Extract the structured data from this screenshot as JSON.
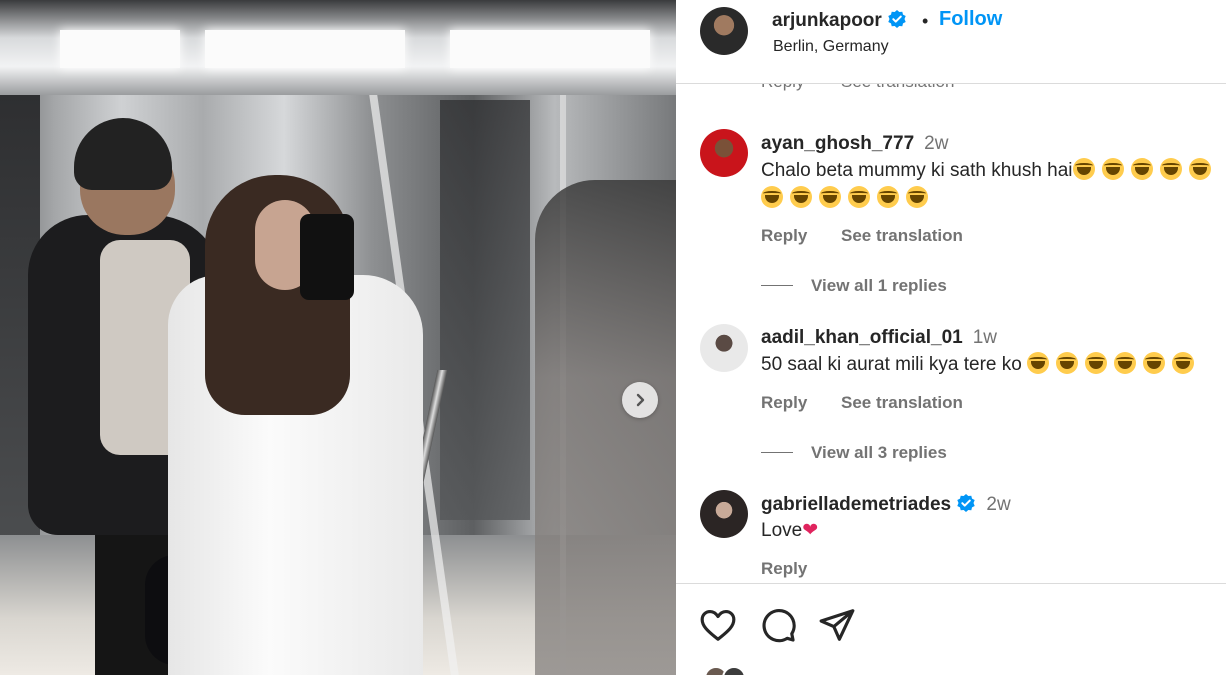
{
  "post": {
    "username": "arjunkapoor",
    "location": "Berlin, Germany",
    "follow_label": "Follow",
    "separator": "•"
  },
  "icons": {
    "verified": "verified-badge-icon",
    "next": "chevron-right-icon",
    "like": "heart-outline-icon",
    "comment": "speech-bubble-icon",
    "share": "paper-plane-icon"
  },
  "colors": {
    "accent": "#0095f6",
    "secondary_text": "#737373",
    "divider": "#dbdbdb"
  },
  "partial_row": {
    "reply": "Reply",
    "translation": "See translation"
  },
  "comments": [
    {
      "username": "ayan_ghosh_777",
      "time": "2w",
      "text": "Chalo beta mummy ki sath khush hai",
      "emoji_line1": 5,
      "emoji_line2": 6,
      "reply": "Reply",
      "translation": "See translation",
      "view_replies": "View all 1 replies"
    },
    {
      "username": "aadil_khan_official_01",
      "time": "1w",
      "text": "50 saal ki aurat mili kya tere ko",
      "emoji_line1": 6,
      "reply": "Reply",
      "translation": "See translation",
      "view_replies": "View all 3 replies"
    },
    {
      "username": "gabriellademetriades",
      "verified": true,
      "time": "2w",
      "text": "Love",
      "reply": "Reply"
    }
  ]
}
